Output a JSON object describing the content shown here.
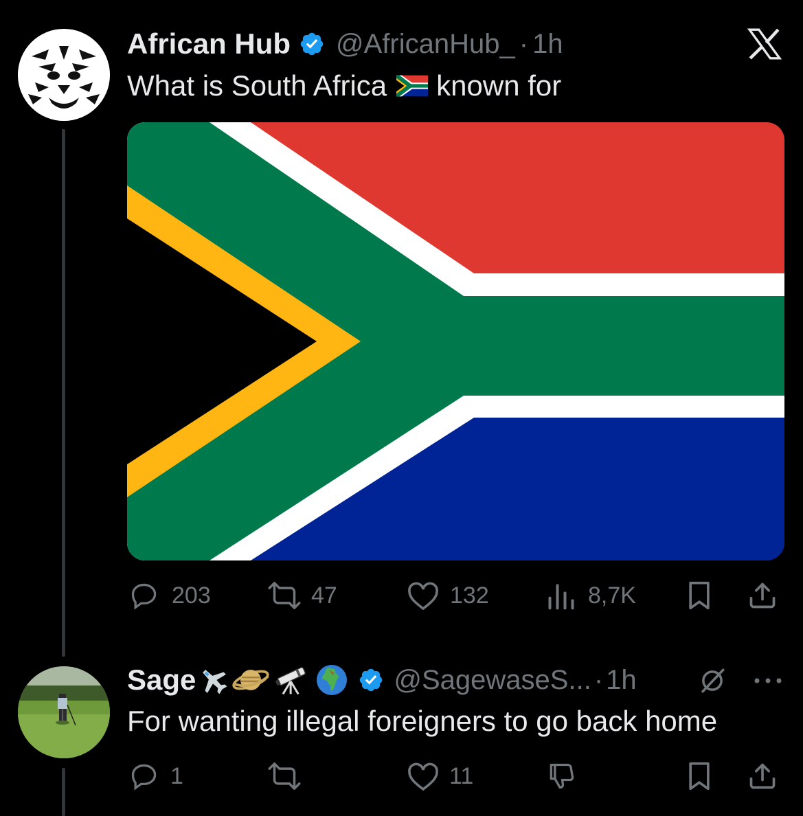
{
  "tweet": {
    "author_name": "African Hub",
    "handle": "@AfricanHub_",
    "separator": "·",
    "time": "1h",
    "text_before_flag": "What is South Africa",
    "text_after_flag": "known for",
    "flag_emoji_name": "south-africa-flag",
    "actions": {
      "replies": "203",
      "reposts": "47",
      "likes": "132",
      "views": "8,7K"
    }
  },
  "reply": {
    "author_name": "Sage",
    "handle": "@SagewaseS...",
    "separator": "·",
    "time": "1h",
    "text": "For wanting illegal foreigners to go back home",
    "name_emojis": [
      "airplane-emoji",
      "ringed-planet-emoji",
      "telescope-emoji",
      "globe-africa-emoji"
    ],
    "actions": {
      "replies": "1",
      "likes": "11"
    }
  },
  "colors": {
    "background": "#000000",
    "text_primary": "#e7e9ea",
    "text_secondary": "#71767b",
    "verified_blue": "#1d9bf0",
    "flag_red": "#de3831",
    "flag_blue": "#002395",
    "flag_green": "#007a4d",
    "flag_gold": "#ffb612"
  }
}
